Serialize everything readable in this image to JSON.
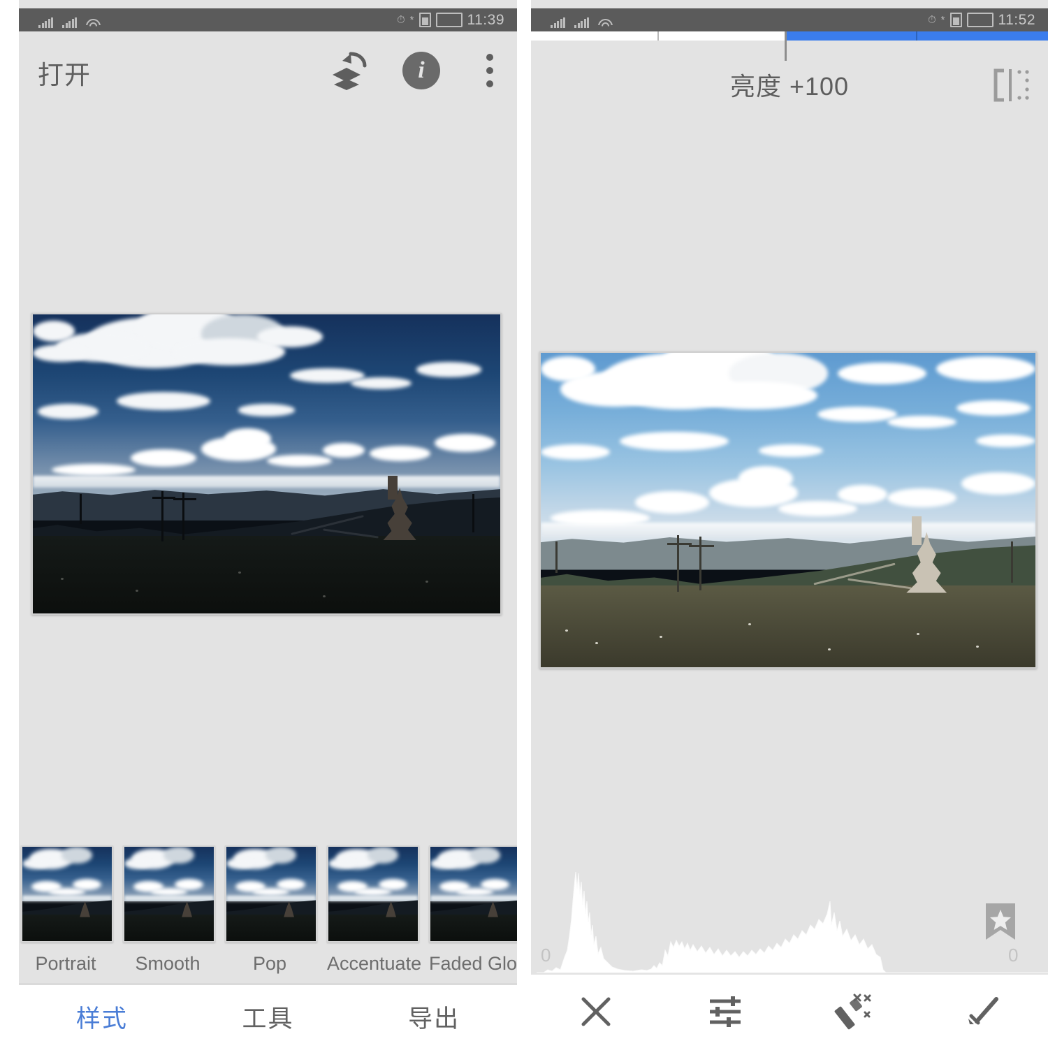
{
  "left": {
    "statusbar": {
      "signal_1_icon": "signal-bars-icon",
      "signal_2_icon": "signal-bars-icon",
      "wifi_icon": "wifi-icon",
      "alarm_icon": "alarm-clock-icon",
      "bluetooth_icon": "bluetooth-icon",
      "battery_icon": "battery-icon",
      "clock": "11:39"
    },
    "appbar": {
      "title": "打开",
      "revert_icon": "revert-layers-icon",
      "info_icon": "info-icon",
      "overflow_icon": "more-vertical-icon"
    },
    "photo": {
      "alt": "mountain-landscape-dark"
    },
    "filters": [
      {
        "label": "Portrait"
      },
      {
        "label": "Smooth"
      },
      {
        "label": "Pop"
      },
      {
        "label": "Accentuate"
      },
      {
        "label": "Faded Glow"
      }
    ],
    "tabs": [
      {
        "label": "样式",
        "active": true
      },
      {
        "label": "工具",
        "active": false
      },
      {
        "label": "导出",
        "active": false
      }
    ]
  },
  "right": {
    "statusbar": {
      "signal_1_icon": "signal-bars-icon",
      "signal_2_icon": "signal-bars-icon",
      "wifi_icon": "wifi-icon",
      "alarm_icon": "alarm-clock-icon",
      "bluetooth_icon": "bluetooth-icon",
      "battery_icon": "battery-icon",
      "clock": "11:52"
    },
    "slider": {
      "title": "亮度 +100",
      "value": 100,
      "fill_percent": 49,
      "thumb_percent": 49,
      "ticks_percent": [
        25,
        49,
        75
      ],
      "compare_icon": "compare-split-icon",
      "fill_color": "#3b7ded"
    },
    "photo": {
      "alt": "mountain-landscape-bright"
    },
    "histogram": {
      "left_label": "0",
      "right_label": "0",
      "bookmark_icon": "bookmark-star-icon"
    },
    "toolbar": [
      {
        "icon": "close-icon",
        "name": "cancel-button"
      },
      {
        "icon": "sliders-icon",
        "name": "adjust-button"
      },
      {
        "icon": "magic-wand-icon",
        "name": "auto-enhance-button"
      },
      {
        "icon": "apply-check-icon",
        "name": "apply-button"
      }
    ]
  },
  "colors": {
    "accent": "#4a7dd6",
    "slider_blue": "#3b7ded",
    "panel_bg": "#e3e3e3",
    "statusbar_bg": "#5b5b5b",
    "text": "#5e5e5e"
  }
}
